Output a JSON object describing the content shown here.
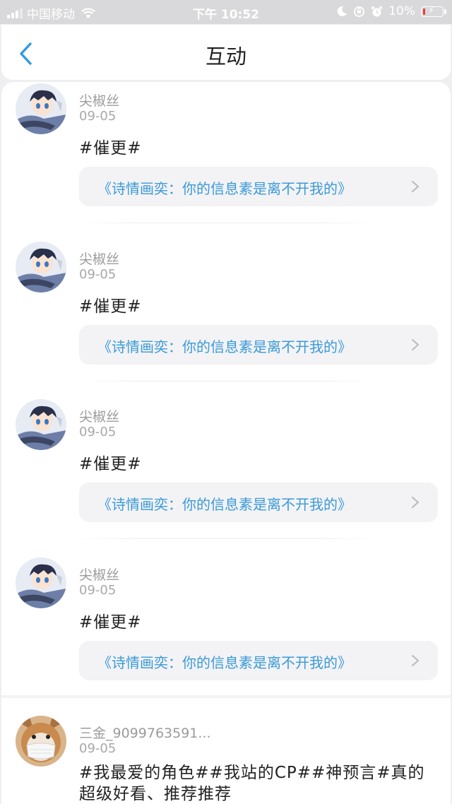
{
  "status_bar": {
    "carrier": "中国移动",
    "time": "下午 10:52",
    "battery": "10%",
    "icons": [
      "signal-icon",
      "wifi-icon",
      "moon-icon",
      "orientation-lock-icon",
      "alarm-icon",
      "battery-icon"
    ]
  },
  "nav": {
    "title": "互动",
    "back_icon": "chevron-left-icon"
  },
  "feed": [
    {
      "name": "尖椒丝",
      "date": "09-05",
      "content": "#催更#",
      "link": "《诗情画奕：你的信息素是离不开我的》",
      "avatar": "anime-boy-avatar"
    },
    {
      "name": "尖椒丝",
      "date": "09-05",
      "content": "#催更#",
      "link": "《诗情画奕：你的信息素是离不开我的》",
      "avatar": "anime-boy-avatar"
    },
    {
      "name": "尖椒丝",
      "date": "09-05",
      "content": "#催更#",
      "link": "《诗情画奕：你的信息素是离不开我的》",
      "avatar": "anime-boy-avatar"
    },
    {
      "name": "尖椒丝",
      "date": "09-05",
      "content": "#催更#",
      "link": "《诗情画奕：你的信息素是离不开我的》",
      "avatar": "anime-boy-avatar"
    },
    {
      "name": "三金_9099763591...",
      "date": "09-05",
      "content": "#我最爱的角色##我站的CP##神预言#真的超级好看、推荐推荐",
      "avatar": "dog-with-mask-avatar"
    }
  ],
  "colors": {
    "link_text": "#3b9ad8",
    "back_icon": "#2f9be0",
    "page_background": "#efeff1"
  }
}
